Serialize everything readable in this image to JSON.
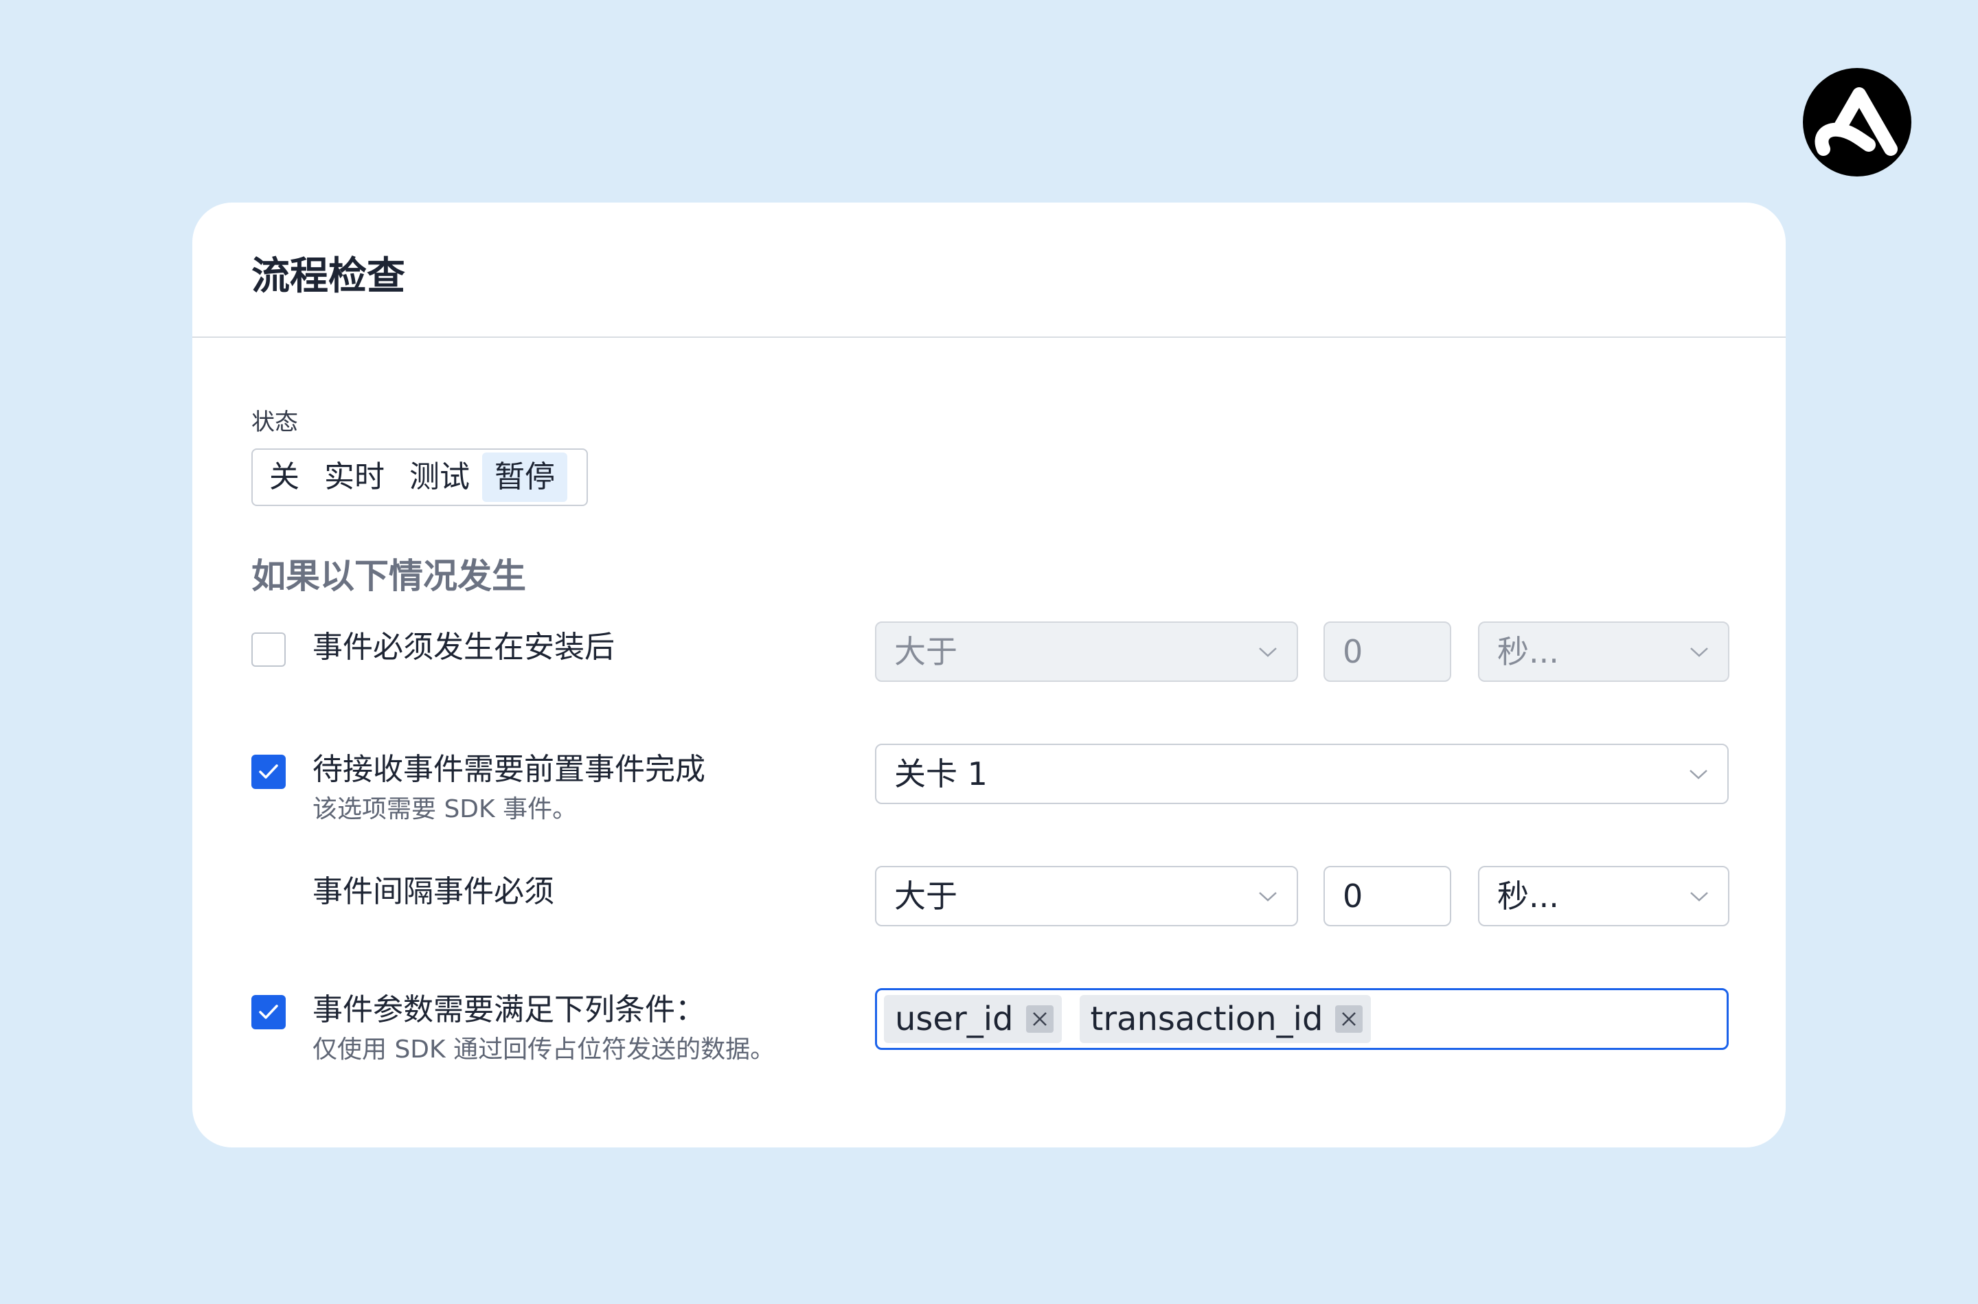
{
  "card": {
    "title": "流程检查",
    "status": {
      "label": "状态",
      "options": [
        "关",
        "实时",
        "测试",
        "暂停"
      ],
      "selected": "暂停"
    },
    "section_heading": "如果以下情况发生"
  },
  "rows": {
    "install": {
      "label": "事件必须发生在安装后",
      "checked": false,
      "comparator": "大于",
      "value": "0",
      "unit": "秒..."
    },
    "prereq": {
      "label": "待接收事件需要前置事件完成",
      "sub": "该选项需要 SDK 事件。",
      "checked": true,
      "event": "关卡 1"
    },
    "interval": {
      "label": "事件间隔事件必须",
      "comparator": "大于",
      "value": "0",
      "unit": "秒..."
    },
    "params": {
      "label": "事件参数需要满足下列条件：",
      "sub": "仅使用 SDK 通过回传占位符发送的数据。",
      "checked": true,
      "tags": [
        "user_id",
        "transaction_id"
      ]
    }
  },
  "icons": {
    "logo": "adjust-logo",
    "dropdown": "chevron-down-icon",
    "check": "check-icon",
    "remove": "close-icon"
  },
  "colors": {
    "background": "#daebf9",
    "accent": "#1b62ea",
    "segment_active": "#e3effc"
  }
}
